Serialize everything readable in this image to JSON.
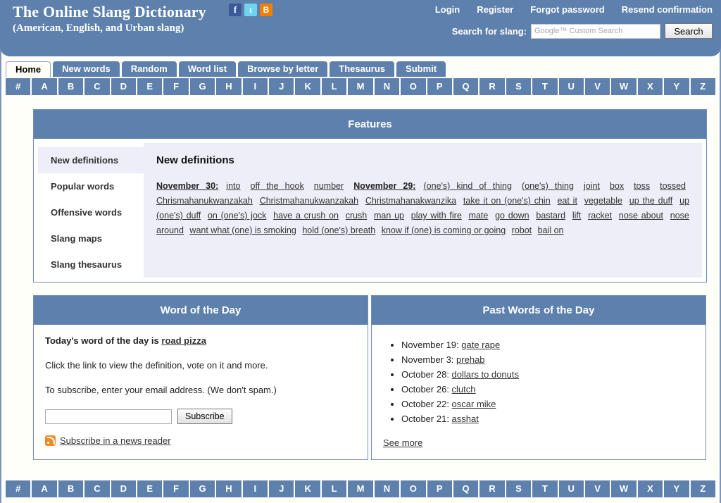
{
  "site": {
    "title": "The Online Slang Dictionary",
    "subtitle": "(American, English, and Urban slang)",
    "social": [
      {
        "name": "facebook-icon",
        "glyph": "f"
      },
      {
        "name": "twitter-icon",
        "glyph": "t"
      },
      {
        "name": "blogger-icon",
        "glyph": "B"
      }
    ]
  },
  "header": {
    "links": [
      "Login",
      "Register",
      "Forgot password",
      "Resend confirmation"
    ],
    "search_label": "Search for slang:",
    "search_placeholder": "Google™ Custom Search",
    "search_value": "",
    "search_button": "Search"
  },
  "tabs": [
    {
      "label": "Home",
      "active": true
    },
    {
      "label": "New words",
      "active": false
    },
    {
      "label": "Random",
      "active": false
    },
    {
      "label": "Word list",
      "active": false
    },
    {
      "label": "Browse by letter",
      "active": false
    },
    {
      "label": "Thesaurus",
      "active": false
    },
    {
      "label": "Submit",
      "active": false
    }
  ],
  "alphabet": [
    "#",
    "A",
    "B",
    "C",
    "D",
    "E",
    "F",
    "G",
    "H",
    "I",
    "J",
    "K",
    "L",
    "M",
    "N",
    "O",
    "P",
    "Q",
    "R",
    "S",
    "T",
    "U",
    "V",
    "W",
    "X",
    "Y",
    "Z"
  ],
  "features": {
    "heading": "Features",
    "sidebar": [
      {
        "label": "New definitions",
        "active": true
      },
      {
        "label": "Popular words",
        "active": false
      },
      {
        "label": "Offensive words",
        "active": false
      },
      {
        "label": "Slang maps",
        "active": false
      },
      {
        "label": "Slang thesaurus",
        "active": false
      }
    ],
    "content_title": "New definitions",
    "groups": [
      {
        "date": "November 30:",
        "words": [
          "into",
          "off the hook",
          "number"
        ]
      },
      {
        "date": "November 29:",
        "words": [
          "(one's) kind of thing",
          "(one's) thing",
          "joint",
          "box",
          "toss",
          "tossed",
          "Chrismahanukwanzakah",
          "Christmahanukwanzakah",
          "Christmahanakwanzika",
          "take it on (one's) chin",
          "eat it",
          "vegetable",
          "up the duff",
          "up (one's) duff",
          "on (one's) jock",
          "have a crush on",
          "crush",
          "man up",
          "play with fire",
          "mate",
          "go down",
          "bastard",
          "lift",
          "racket",
          "nose about",
          "nose around",
          "want what (one) is smoking",
          "hold (one's) breath",
          "know if (one) is coming or going",
          "robot",
          "bail on"
        ]
      }
    ]
  },
  "word_of_the_day": {
    "heading": "Word of the Day",
    "intro_prefix": "Today's word of the day is",
    "word": "road pizza",
    "description": "Click the link to view the definition, vote on it and more.",
    "subscribe_text": "To subscribe, enter your email address. (We don't spam.)",
    "email_value": "",
    "subscribe_button": "Subscribe",
    "rss_label": "Subscribe in a news reader"
  },
  "past_words": {
    "heading": "Past Words of the Day",
    "items": [
      {
        "date": "November 19:",
        "word": "gate rape"
      },
      {
        "date": "November 3:",
        "word": "prehab"
      },
      {
        "date": "October 28:",
        "word": "dollars to donuts"
      },
      {
        "date": "October 26:",
        "word": "clutch"
      },
      {
        "date": "October 22:",
        "word": "oscar mike"
      },
      {
        "date": "October 21:",
        "word": "asshat"
      }
    ],
    "see_more": "See more"
  },
  "colors": {
    "header_blue": "#5e80ac",
    "panel_border": "#6f8db4",
    "content_lavender": "#eeeef8",
    "page_bg": "#fffffa",
    "rss_orange": "#f08a24"
  }
}
